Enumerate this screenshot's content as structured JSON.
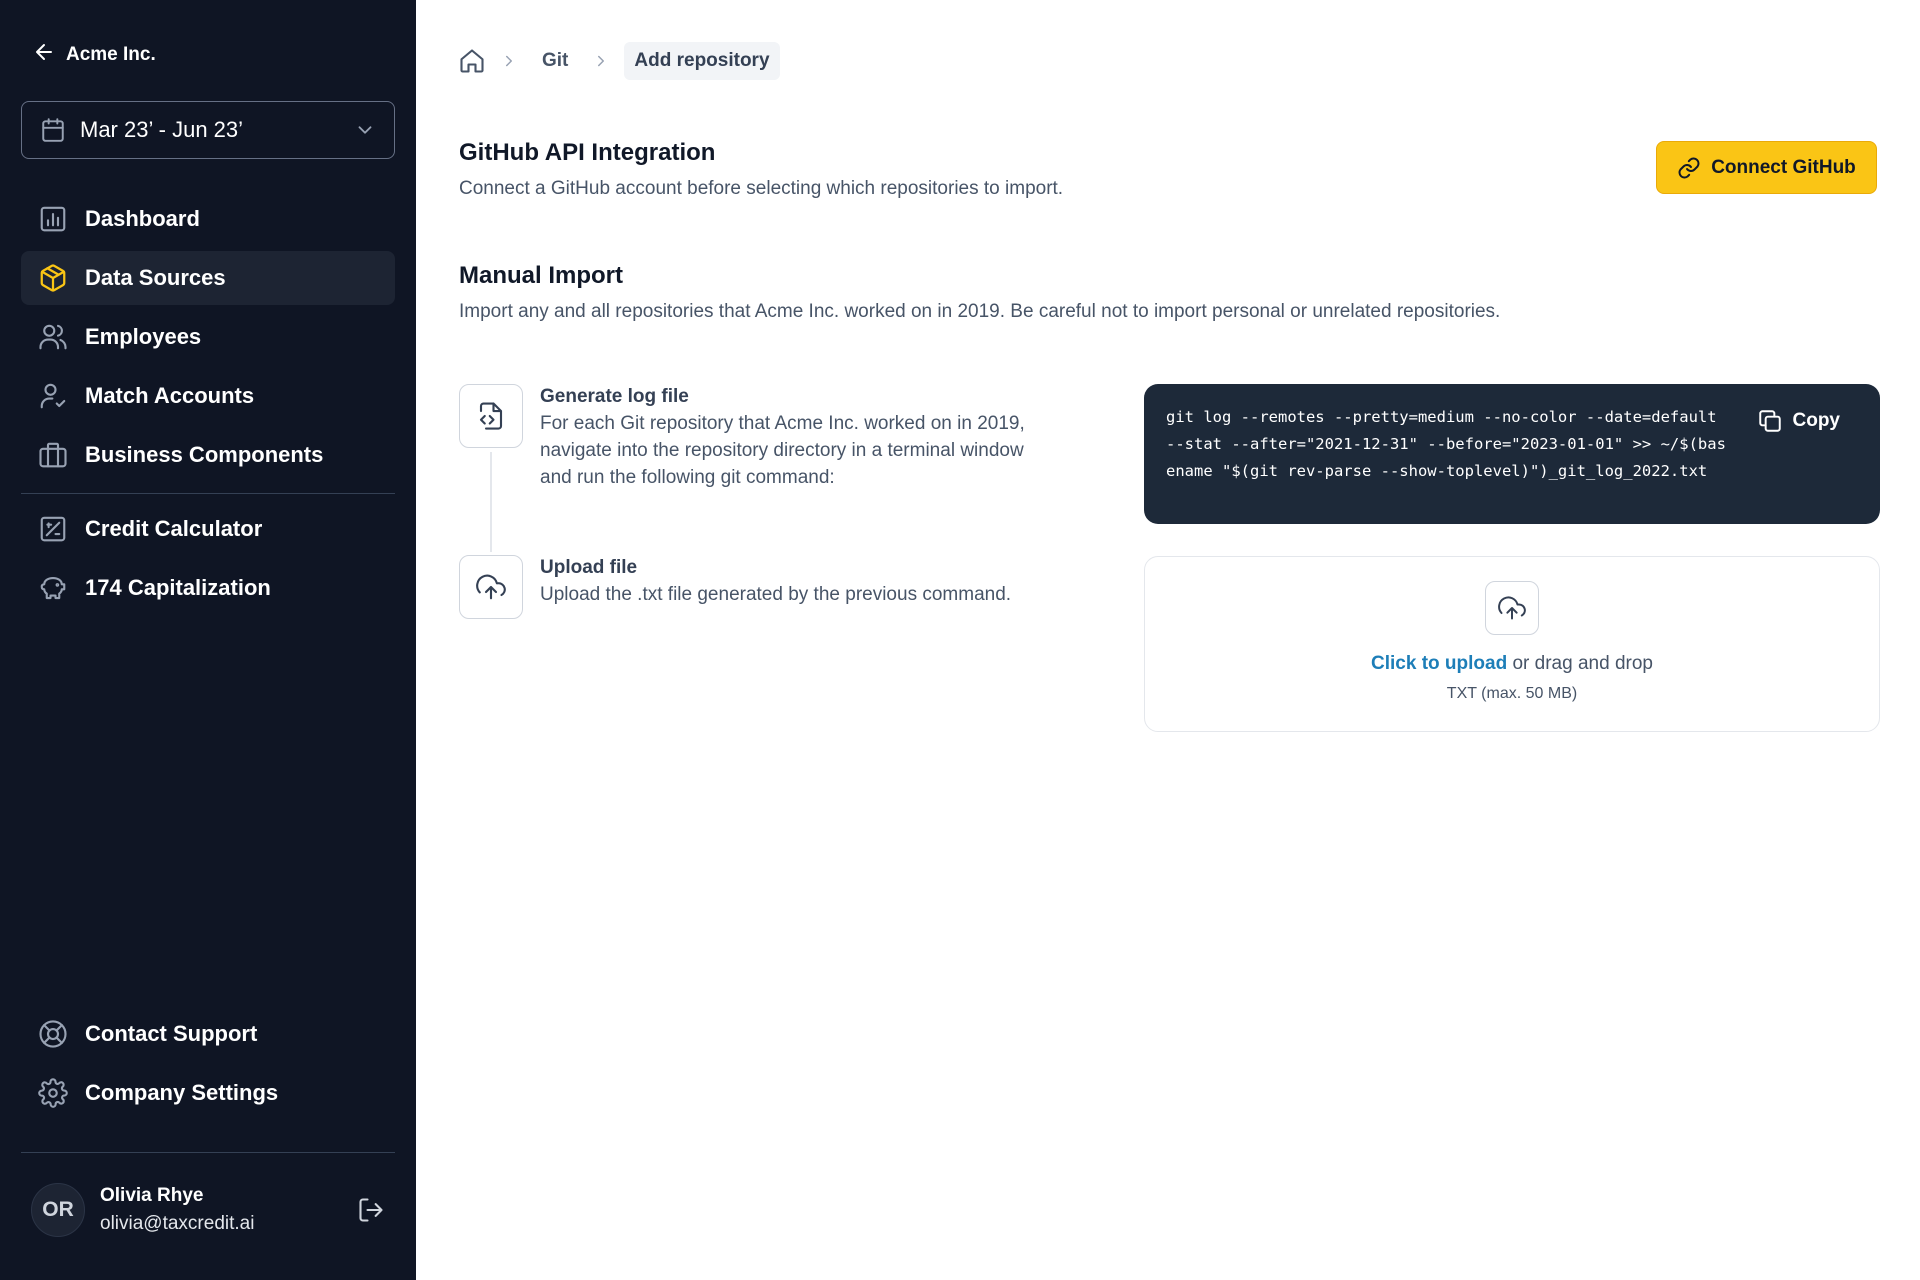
{
  "sidebar": {
    "org_name": "Acme Inc.",
    "date_range": "Mar 23’ - Jun 23’",
    "nav_top": [
      {
        "label": "Dashboard",
        "icon": "bar-chart-icon"
      },
      {
        "label": "Data Sources",
        "icon": "cube-icon",
        "active": true
      },
      {
        "label": "Employees",
        "icon": "users-icon"
      },
      {
        "label": "Match Accounts",
        "icon": "user-check-icon"
      },
      {
        "label": "Business Components",
        "icon": "building-icon"
      }
    ],
    "nav_mid": [
      {
        "label": "Credit Calculator",
        "icon": "calculator-icon"
      },
      {
        "label": "174 Capitalization",
        "icon": "piggy-bank-icon"
      }
    ],
    "nav_bottom": [
      {
        "label": "Contact Support",
        "icon": "life-buoy-icon"
      },
      {
        "label": "Company Settings",
        "icon": "gear-icon"
      }
    ],
    "user": {
      "initials": "OR",
      "name": "Olivia Rhye",
      "email": "olivia@taxcredit.ai"
    },
    "accent_color": "#fac515"
  },
  "breadcrumb": {
    "items": [
      "Git",
      "Add repository"
    ]
  },
  "github": {
    "title": "GitHub API Integration",
    "description": "Connect a GitHub account before selecting which repositories to import.",
    "button_label": "Connect GitHub"
  },
  "manual": {
    "title": "Manual Import",
    "description": "Import any and all repositories that Acme Inc. worked on in 2019. Be careful not to import personal or unrelated repositories.",
    "steps": [
      {
        "title": "Generate log file",
        "description": "For each Git repository that Acme Inc. worked on in 2019, navigate into the repository directory in a terminal window and run the following git command:"
      },
      {
        "title": "Upload file",
        "description": "Upload the .txt file generated by the previous command."
      }
    ],
    "code": "git log --remotes --pretty=medium --no-color --date=default --stat --after=\"2021-12-31\" --before=\"2023-01-01\" >> ~/$(basename \"$(git rev-parse --show-toplevel)\")_git_log_2022.txt",
    "copy_label": "Copy",
    "upload": {
      "link_text": "Click to upload",
      "rest_text": " or drag and drop",
      "hint": "TXT (max. 50 MB)"
    }
  }
}
